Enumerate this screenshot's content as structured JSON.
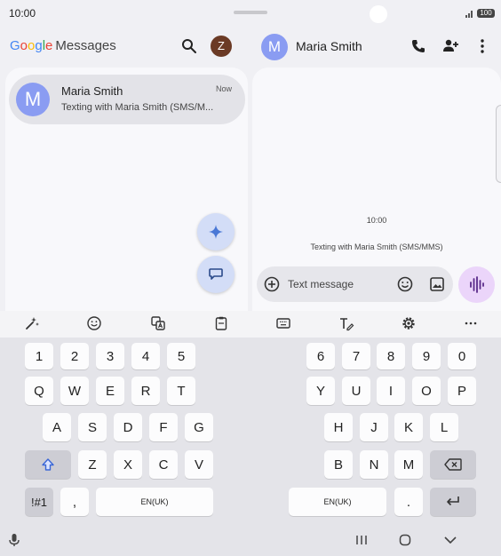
{
  "status_bar": {
    "time": "10:00",
    "battery": "100"
  },
  "left_header": {
    "logo_google": [
      "G",
      "o",
      "o",
      "g",
      "l",
      "e"
    ],
    "logo_messages": "Messages",
    "account_initial": "Z"
  },
  "conversations": [
    {
      "initial": "M",
      "name": "Maria Smith",
      "time": "Now",
      "snippet": "Texting with Maria Smith (SMS/M..."
    }
  ],
  "right_header": {
    "initial": "M",
    "name": "Maria Smith"
  },
  "chat": {
    "timestamp": "10:00",
    "info": "Texting with Maria Smith (SMS/MMS)",
    "compose_placeholder": "Text message"
  },
  "keyboard": {
    "left": {
      "row1": [
        "1",
        "2",
        "3",
        "4",
        "5"
      ],
      "row2": [
        "Q",
        "W",
        "E",
        "R",
        "T"
      ],
      "row3": [
        "A",
        "S",
        "D",
        "F",
        "G"
      ],
      "row4": [
        "Z",
        "X",
        "C",
        "V"
      ],
      "symbols": "!#1",
      "comma": ",",
      "space": "EN(UK)"
    },
    "right": {
      "row1": [
        "6",
        "7",
        "8",
        "9",
        "0"
      ],
      "row2": [
        "Y",
        "U",
        "I",
        "O",
        "P"
      ],
      "row3": [
        "H",
        "J",
        "K",
        "L"
      ],
      "row4": [
        "B",
        "N",
        "M"
      ],
      "space": "EN(UK)",
      "period": "."
    }
  },
  "colors": {
    "accent": "#8a9cf2",
    "voice": "#ebd5fa",
    "fab": "#d3ddf7"
  }
}
